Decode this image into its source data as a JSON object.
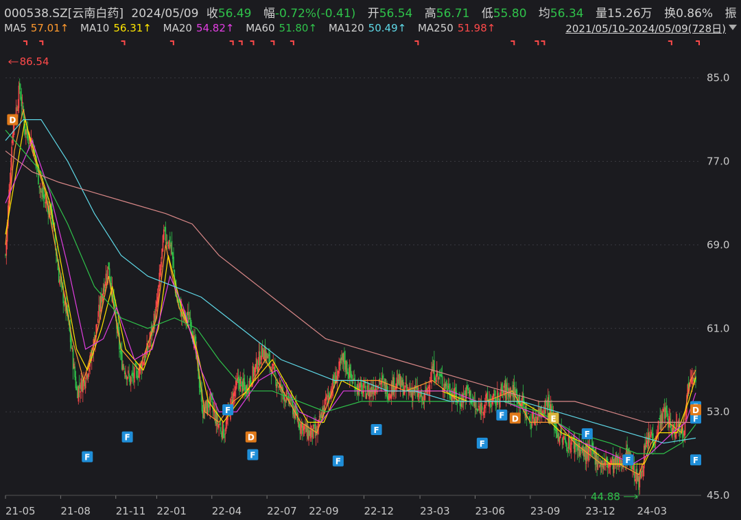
{
  "header": {
    "code": "000538.SZ[云南白药]",
    "date": "2024/05/09",
    "close_label": "收",
    "close": "56.49",
    "change_label": "幅",
    "change": "-0.72%(-0.41)",
    "open_label": "开",
    "open": "56.54",
    "high_label": "高",
    "high": "56.71",
    "low_label": "低",
    "low": "55.80",
    "avg_label": "均",
    "avg": "56.34",
    "vol_label": "量",
    "vol": "15.26万",
    "turn_label": "换",
    "turn": "0.86%",
    "amp_label": "振",
    "more": "..."
  },
  "ma_row": {
    "ma5_label": "MA5",
    "ma5": "57.01↑",
    "ma10_label": "MA10",
    "ma10": "56.31↑",
    "ma20_label": "MA20",
    "ma20": "54.82↑",
    "ma60_label": "MA60",
    "ma60": "51.80↑",
    "ma120_label": "MA120",
    "ma120": "50.49↑",
    "ma250_label": "MA250",
    "ma250": "51.98↑",
    "range": "2021/05/10-2024/05/09(728日)"
  },
  "colors": {
    "ma5": "#ff9a2e",
    "ma10": "#ffe600",
    "ma20": "#e23ee2",
    "ma60": "#2fc24a",
    "ma120": "#5fd9e8",
    "ma250": "#d98888",
    "up": "#ff4a4a",
    "down": "#2fc24a",
    "grid": "#3a3a40"
  },
  "chart_data": {
    "type": "candlestick",
    "ylim": [
      45.0,
      88.0
    ],
    "y_ticks": [
      "85.0",
      "77.0",
      "69.0",
      "61.0",
      "53.0",
      "45.0"
    ],
    "y_tick_values": [
      85,
      77,
      69,
      61,
      53,
      45
    ],
    "x_ticks": [
      "21-05",
      "21-08",
      "21-11",
      "22-01",
      "22-04",
      "22-07",
      "22-09",
      "22-12",
      "23-03",
      "23-06",
      "23-09",
      "23-12",
      "24-03"
    ],
    "x_tick_index": [
      0,
      62,
      124,
      170,
      232,
      294,
      341,
      403,
      466,
      528,
      590,
      652,
      710
    ],
    "n_days": 728,
    "max_label": "86.54",
    "max_value": 86.54,
    "max_index": 2,
    "min_label": "44.88",
    "min_value": 44.88,
    "min_index": 712,
    "close_path": [
      [
        0,
        68
      ],
      [
        8,
        80
      ],
      [
        16,
        84
      ],
      [
        22,
        80
      ],
      [
        30,
        79
      ],
      [
        40,
        74
      ],
      [
        52,
        72
      ],
      [
        60,
        66
      ],
      [
        70,
        62
      ],
      [
        80,
        55
      ],
      [
        88,
        56
      ],
      [
        96,
        58
      ],
      [
        104,
        62
      ],
      [
        110,
        65
      ],
      [
        116,
        67
      ],
      [
        122,
        63
      ],
      [
        130,
        58
      ],
      [
        140,
        56
      ],
      [
        150,
        57
      ],
      [
        160,
        59
      ],
      [
        170,
        63
      ],
      [
        178,
        70
      ],
      [
        186,
        69
      ],
      [
        192,
        64
      ],
      [
        200,
        62
      ],
      [
        208,
        62
      ],
      [
        215,
        58
      ],
      [
        222,
        53
      ],
      [
        230,
        54
      ],
      [
        238,
        52
      ],
      [
        246,
        51
      ],
      [
        254,
        54
      ],
      [
        262,
        56
      ],
      [
        270,
        55
      ],
      [
        280,
        57
      ],
      [
        290,
        59
      ],
      [
        300,
        57
      ],
      [
        310,
        55
      ],
      [
        320,
        54
      ],
      [
        330,
        52
      ],
      [
        340,
        51
      ],
      [
        350,
        51
      ],
      [
        360,
        54
      ],
      [
        370,
        56
      ],
      [
        380,
        58
      ],
      [
        390,
        56
      ],
      [
        400,
        55
      ],
      [
        410,
        55
      ],
      [
        420,
        56
      ],
      [
        430,
        55
      ],
      [
        440,
        56
      ],
      [
        450,
        55
      ],
      [
        460,
        55
      ],
      [
        470,
        54
      ],
      [
        480,
        57
      ],
      [
        490,
        56
      ],
      [
        500,
        55
      ],
      [
        510,
        54
      ],
      [
        520,
        55
      ],
      [
        530,
        53
      ],
      [
        540,
        54
      ],
      [
        550,
        54
      ],
      [
        560,
        55
      ],
      [
        570,
        55
      ],
      [
        580,
        54
      ],
      [
        590,
        52
      ],
      [
        600,
        53
      ],
      [
        610,
        54
      ],
      [
        620,
        51
      ],
      [
        630,
        50
      ],
      [
        640,
        50
      ],
      [
        650,
        49
      ],
      [
        660,
        49
      ],
      [
        670,
        48
      ],
      [
        680,
        48
      ],
      [
        690,
        48
      ],
      [
        700,
        49
      ],
      [
        712,
        46
      ],
      [
        718,
        49
      ],
      [
        726,
        51
      ],
      [
        728,
        50
      ],
      [
        735,
        52
      ],
      [
        742,
        53
      ],
      [
        750,
        51
      ],
      [
        756,
        52
      ],
      [
        762,
        51
      ],
      [
        768,
        56
      ],
      [
        772,
        57
      ],
      [
        776,
        56.49
      ]
    ],
    "ma_series": [
      {
        "name": "MA5",
        "color_key": "ma5",
        "values": [
          [
            0,
            69
          ],
          [
            10,
            78
          ],
          [
            20,
            82
          ],
          [
            30,
            78
          ],
          [
            45,
            74
          ],
          [
            60,
            67
          ],
          [
            75,
            60
          ],
          [
            88,
            56
          ],
          [
            104,
            61
          ],
          [
            116,
            66
          ],
          [
            130,
            59
          ],
          [
            150,
            57
          ],
          [
            170,
            62
          ],
          [
            180,
            69
          ],
          [
            195,
            63
          ],
          [
            212,
            60
          ],
          [
            224,
            53
          ],
          [
            240,
            52
          ],
          [
            256,
            54
          ],
          [
            272,
            55
          ],
          [
            292,
            58
          ],
          [
            312,
            55
          ],
          [
            332,
            52
          ],
          [
            350,
            51
          ],
          [
            372,
            56
          ],
          [
            392,
            56
          ],
          [
            420,
            56
          ],
          [
            450,
            55
          ],
          [
            480,
            56
          ],
          [
            510,
            54
          ],
          [
            540,
            54
          ],
          [
            570,
            55
          ],
          [
            590,
            52
          ],
          [
            620,
            52
          ],
          [
            640,
            50
          ],
          [
            670,
            48
          ],
          [
            690,
            48
          ],
          [
            712,
            47
          ],
          [
            726,
            50
          ],
          [
            745,
            52
          ],
          [
            760,
            51
          ],
          [
            770,
            56
          ],
          [
            776,
            57.01
          ]
        ]
      },
      {
        "name": "MA10",
        "color_key": "ma10",
        "values": [
          [
            0,
            70
          ],
          [
            12,
            76
          ],
          [
            22,
            81
          ],
          [
            35,
            77
          ],
          [
            50,
            73
          ],
          [
            65,
            66
          ],
          [
            80,
            59
          ],
          [
            92,
            57
          ],
          [
            108,
            61
          ],
          [
            120,
            65
          ],
          [
            135,
            59
          ],
          [
            155,
            57
          ],
          [
            172,
            61
          ],
          [
            183,
            68
          ],
          [
            198,
            63
          ],
          [
            215,
            59
          ],
          [
            228,
            54
          ],
          [
            245,
            52
          ],
          [
            262,
            54
          ],
          [
            280,
            56
          ],
          [
            300,
            58
          ],
          [
            320,
            55
          ],
          [
            340,
            52
          ],
          [
            358,
            52
          ],
          [
            378,
            56
          ],
          [
            400,
            55
          ],
          [
            430,
            55
          ],
          [
            460,
            55
          ],
          [
            490,
            55
          ],
          [
            520,
            54
          ],
          [
            550,
            54
          ],
          [
            580,
            54
          ],
          [
            600,
            53
          ],
          [
            625,
            51
          ],
          [
            650,
            50
          ],
          [
            680,
            48
          ],
          [
            705,
            48
          ],
          [
            718,
            48
          ],
          [
            735,
            51
          ],
          [
            755,
            51
          ],
          [
            768,
            54
          ],
          [
            776,
            56.31
          ]
        ]
      },
      {
        "name": "MA20",
        "color_key": "ma20",
        "values": [
          [
            0,
            73
          ],
          [
            15,
            76
          ],
          [
            30,
            79
          ],
          [
            50,
            74
          ],
          [
            70,
            67
          ],
          [
            90,
            59
          ],
          [
            110,
            60
          ],
          [
            125,
            63
          ],
          [
            145,
            58
          ],
          [
            165,
            59
          ],
          [
            185,
            66
          ],
          [
            200,
            63
          ],
          [
            220,
            57
          ],
          [
            240,
            53
          ],
          [
            260,
            53
          ],
          [
            285,
            56
          ],
          [
            305,
            57
          ],
          [
            330,
            53
          ],
          [
            355,
            52
          ],
          [
            380,
            55
          ],
          [
            410,
            55
          ],
          [
            440,
            55
          ],
          [
            470,
            55
          ],
          [
            500,
            55
          ],
          [
            530,
            54
          ],
          [
            560,
            54
          ],
          [
            590,
            53
          ],
          [
            620,
            52
          ],
          [
            650,
            50
          ],
          [
            680,
            49
          ],
          [
            705,
            48
          ],
          [
            725,
            49
          ],
          [
            750,
            51
          ],
          [
            765,
            52
          ],
          [
            776,
            54.82
          ]
        ]
      },
      {
        "name": "MA60",
        "color_key": "ma60",
        "values": [
          [
            0,
            80
          ],
          [
            20,
            78
          ],
          [
            40,
            76
          ],
          [
            70,
            71
          ],
          [
            100,
            65
          ],
          [
            130,
            62
          ],
          [
            160,
            61
          ],
          [
            190,
            62
          ],
          [
            215,
            61
          ],
          [
            240,
            58
          ],
          [
            270,
            55
          ],
          [
            300,
            55
          ],
          [
            330,
            54
          ],
          [
            360,
            53
          ],
          [
            400,
            54
          ],
          [
            440,
            54
          ],
          [
            480,
            54
          ],
          [
            520,
            54
          ],
          [
            560,
            54
          ],
          [
            600,
            53
          ],
          [
            640,
            51
          ],
          [
            680,
            50
          ],
          [
            710,
            49
          ],
          [
            740,
            49
          ],
          [
            760,
            50
          ],
          [
            776,
            51.8
          ]
        ]
      },
      {
        "name": "MA120",
        "color_key": "ma120",
        "values": [
          [
            0,
            79
          ],
          [
            20,
            81
          ],
          [
            40,
            81
          ],
          [
            70,
            77
          ],
          [
            100,
            72
          ],
          [
            130,
            68
          ],
          [
            160,
            66
          ],
          [
            190,
            65
          ],
          [
            220,
            64
          ],
          [
            250,
            62
          ],
          [
            280,
            60
          ],
          [
            310,
            58
          ],
          [
            340,
            57
          ],
          [
            370,
            56
          ],
          [
            400,
            56
          ],
          [
            430,
            55
          ],
          [
            460,
            55
          ],
          [
            500,
            54
          ],
          [
            540,
            54
          ],
          [
            580,
            54
          ],
          [
            620,
            53
          ],
          [
            660,
            52
          ],
          [
            700,
            51
          ],
          [
            740,
            50
          ],
          [
            776,
            50.49
          ]
        ]
      },
      {
        "name": "MA250",
        "color_key": "ma250",
        "values": [
          [
            0,
            78
          ],
          [
            30,
            76
          ],
          [
            60,
            75
          ],
          [
            100,
            74
          ],
          [
            140,
            73
          ],
          [
            180,
            72
          ],
          [
            210,
            71
          ],
          [
            240,
            68
          ],
          [
            270,
            66
          ],
          [
            300,
            64
          ],
          [
            330,
            62
          ],
          [
            360,
            60
          ],
          [
            400,
            59
          ],
          [
            440,
            58
          ],
          [
            480,
            57
          ],
          [
            520,
            56
          ],
          [
            560,
            55
          ],
          [
            600,
            54
          ],
          [
            640,
            54
          ],
          [
            680,
            53
          ],
          [
            720,
            52
          ],
          [
            760,
            52
          ],
          [
            776,
            51.98
          ]
        ]
      }
    ],
    "markers": [
      {
        "label": "D",
        "type": "D",
        "i": 8,
        "v": 81
      },
      {
        "label": "F",
        "type": "F",
        "i": 92,
        "v": 48.7
      },
      {
        "label": "F",
        "type": "F",
        "i": 137,
        "v": 50.6
      },
      {
        "label": "F",
        "type": "F",
        "i": 250,
        "v": 53.2
      },
      {
        "label": "D",
        "type": "D",
        "i": 276,
        "v": 50.6
      },
      {
        "label": "F",
        "type": "F",
        "i": 278,
        "v": 48.9
      },
      {
        "label": "F",
        "type": "F",
        "i": 374,
        "v": 48.3
      },
      {
        "label": "F",
        "type": "F",
        "i": 417,
        "v": 51.3
      },
      {
        "label": "F",
        "type": "F",
        "i": 536,
        "v": 50.0
      },
      {
        "label": "F",
        "type": "F",
        "i": 558,
        "v": 52.7
      },
      {
        "label": "D",
        "type": "D",
        "i": 573,
        "v": 52.4
      },
      {
        "label": "E",
        "type": "E",
        "i": 616,
        "v": 52.4
      },
      {
        "label": "F",
        "type": "F",
        "i": 654,
        "v": 50.9
      },
      {
        "label": "F",
        "type": "F",
        "i": 700,
        "v": 48.4
      },
      {
        "label": "F",
        "type": "F",
        "i": 818,
        "v": 48.4
      },
      {
        "label": "F",
        "type": "F",
        "i": 836,
        "v": 52.4
      },
      {
        "label": "F",
        "type": "F",
        "i": 837,
        "v": 53.5
      },
      {
        "label": "D",
        "type": "D",
        "i": 845,
        "v": 53.2
      }
    ],
    "top_flags": [
      20,
      38,
      130,
      185,
      252,
      262,
      275,
      298,
      320,
      460,
      568,
      595,
      602,
      745,
      825
    ]
  }
}
